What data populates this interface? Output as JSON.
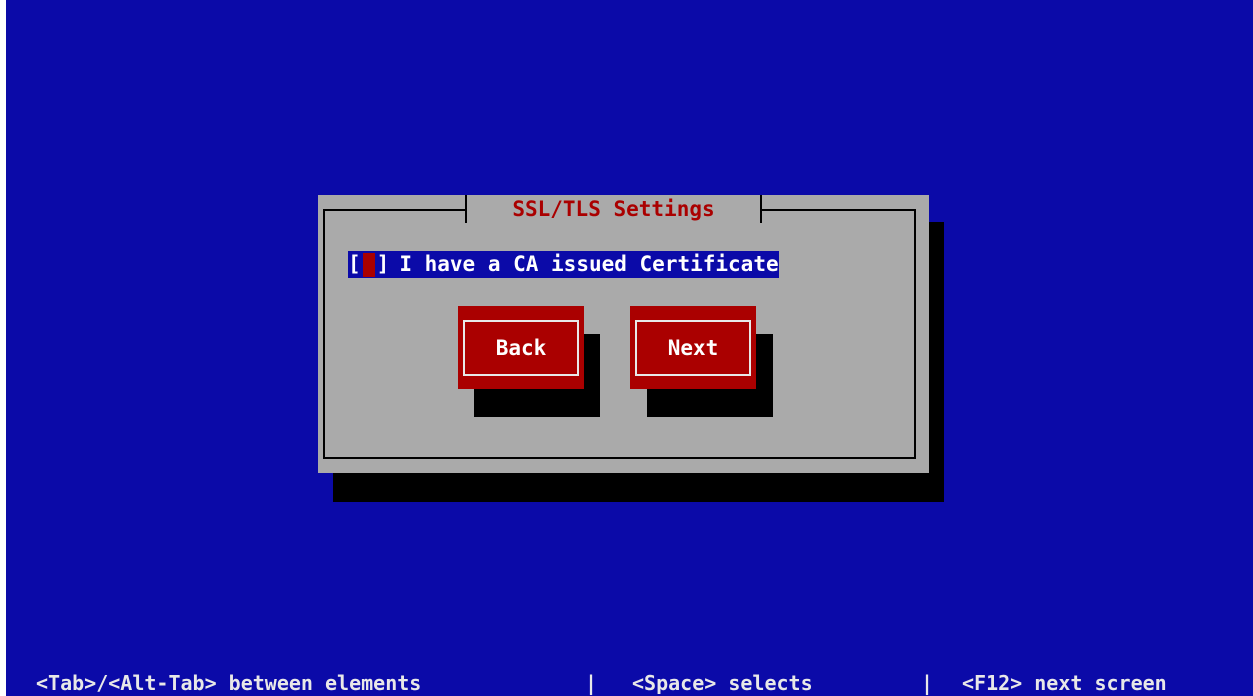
{
  "dialog": {
    "title": "SSL/TLS Settings",
    "checkbox": {
      "open_bracket": "[",
      "close_bracket": "]",
      "checked": false,
      "label": "I have a CA issued Certificate"
    },
    "buttons": {
      "back_label": "Back",
      "next_label": "Next"
    }
  },
  "footer": {
    "hint_tab": "<Tab>/<Alt-Tab> between elements",
    "separator": "|",
    "hint_space": "<Space> selects",
    "hint_f12": "<F12> next screen"
  },
  "colors": {
    "screen_background": "#0b0aa8",
    "dialog_background": "#aaaaaa",
    "accent": "#aa0000",
    "text": "#ffffff",
    "shadow": "#000000"
  }
}
